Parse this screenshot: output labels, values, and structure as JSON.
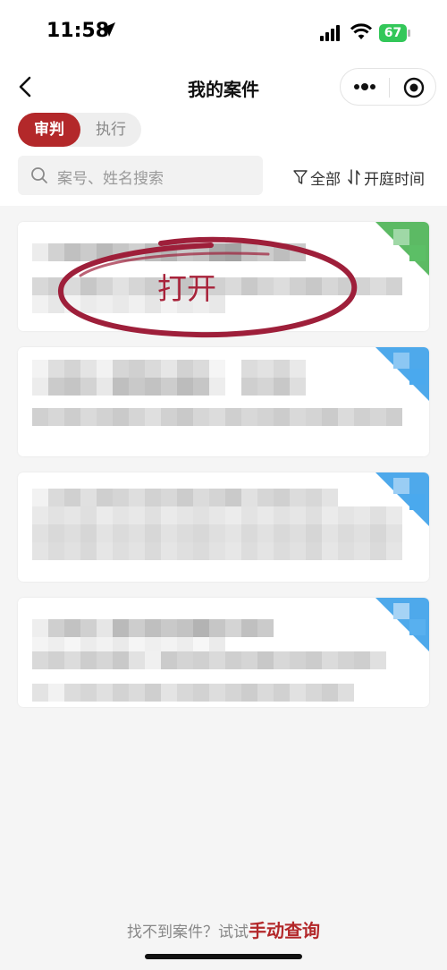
{
  "status_bar": {
    "time": "11:58",
    "battery": "67"
  },
  "nav": {
    "title": "我的案件"
  },
  "tabs": [
    {
      "label": "审判",
      "active": true
    },
    {
      "label": "执行",
      "active": false
    }
  ],
  "search": {
    "placeholder": "案号、姓名搜索"
  },
  "filters": {
    "scope_label": "全部",
    "sort_label": "开庭时间"
  },
  "annotation": {
    "text": "打开"
  },
  "cards": [
    {
      "tag_color": "#3fae49"
    },
    {
      "tag_color": "#2f9ae8"
    },
    {
      "tag_color": "#2f9ae8"
    },
    {
      "tag_color": "#2f9ae8"
    }
  ],
  "footer": {
    "prefix": "找不到案件？试试",
    "link": "手动查询"
  },
  "colors": {
    "accent": "#b3282a",
    "annotation": "#a8233a"
  }
}
